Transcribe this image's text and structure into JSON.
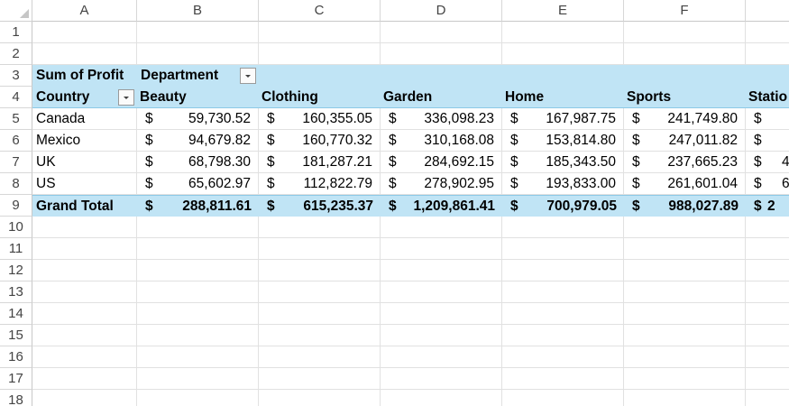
{
  "columns": [
    "A",
    "B",
    "C",
    "D",
    "E",
    "F"
  ],
  "rows": [
    "1",
    "2",
    "3",
    "4",
    "5",
    "6",
    "7",
    "8",
    "9",
    "10",
    "11",
    "12",
    "13",
    "14",
    "15",
    "16",
    "17",
    "18"
  ],
  "pivot": {
    "value_label": "Sum of Profit",
    "column_field": "Department",
    "row_field": "Country",
    "departments": [
      "Beauty",
      "Clothing",
      "Garden",
      "Home",
      "Sports",
      "Statio"
    ],
    "currency_symbol": "$",
    "body": [
      {
        "country": "Canada",
        "values": [
          "59,730.52",
          "160,355.05",
          "336,098.23",
          "167,987.75",
          "241,749.80",
          ""
        ]
      },
      {
        "country": "Mexico",
        "values": [
          "94,679.82",
          "160,770.32",
          "310,168.08",
          "153,814.80",
          "247,011.82",
          ""
        ]
      },
      {
        "country": "UK",
        "values": [
          "68,798.30",
          "181,287.21",
          "284,692.15",
          "185,343.50",
          "237,665.23",
          "4"
        ]
      },
      {
        "country": "US",
        "values": [
          "65,602.97",
          "112,822.79",
          "278,902.95",
          "193,833.00",
          "261,601.04",
          "6"
        ]
      }
    ],
    "grand_total": {
      "label": "Grand Total",
      "values": [
        "288,811.61",
        "615,235.37",
        "1,209,861.41",
        "700,979.05",
        "988,027.89",
        "2"
      ]
    }
  },
  "colors": {
    "pivot_fill": "#c0e4f5",
    "pivot_border": "#8cc9e6",
    "grid_line": "#e1e1e1",
    "header_text": "#444444"
  }
}
